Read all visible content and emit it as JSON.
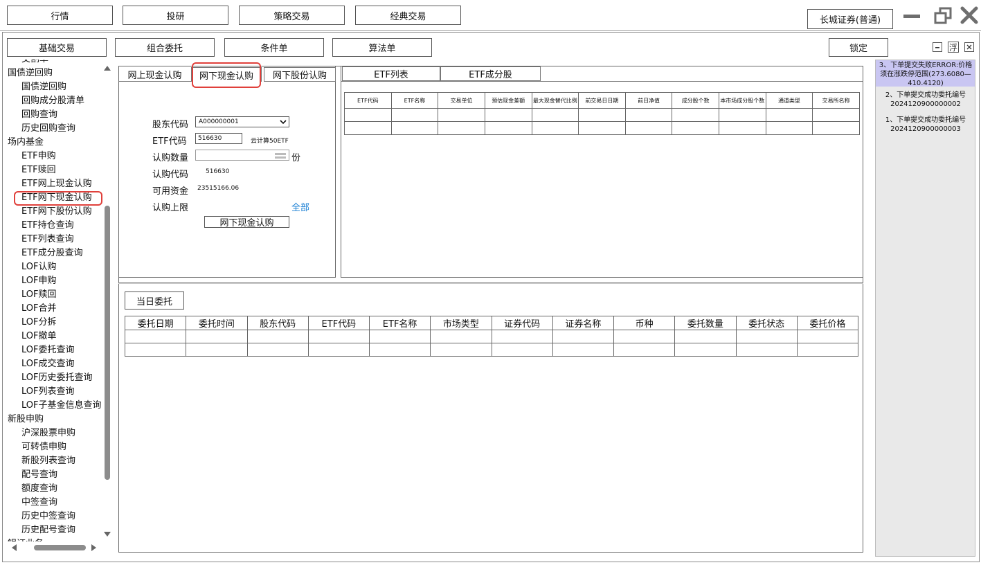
{
  "top_menu": {
    "items": [
      "行情",
      "投研",
      "策略交易",
      "经典交易"
    ],
    "broker_label": "长城证券(普通)"
  },
  "sub_menu": {
    "items": [
      "基础交易",
      "组合委托",
      "条件单",
      "算法单"
    ],
    "lock_label": "锁定"
  },
  "sidebar": {
    "rows": [
      {
        "label": "交割单",
        "level": 1
      },
      {
        "label": "国债逆回购",
        "level": 0
      },
      {
        "label": "国债逆回购",
        "level": 1
      },
      {
        "label": "回购成分股清单",
        "level": 1
      },
      {
        "label": "回购查询",
        "level": 1
      },
      {
        "label": "历史回购查询",
        "level": 1
      },
      {
        "label": "场内基金",
        "level": 0
      },
      {
        "label": "ETF申购",
        "level": 1
      },
      {
        "label": "ETF赎回",
        "level": 1
      },
      {
        "label": "ETF网上现金认购",
        "level": 1
      },
      {
        "label": "ETF网下现金认购",
        "level": 1
      },
      {
        "label": "ETF网下股份认购",
        "level": 1
      },
      {
        "label": "ETF持仓查询",
        "level": 1
      },
      {
        "label": "ETF列表查询",
        "level": 1
      },
      {
        "label": "ETF成分股查询",
        "level": 1
      },
      {
        "label": "LOF认购",
        "level": 1
      },
      {
        "label": "LOF申购",
        "level": 1
      },
      {
        "label": "LOF赎回",
        "level": 1
      },
      {
        "label": "LOF合并",
        "level": 1
      },
      {
        "label": "LOF分拆",
        "level": 1
      },
      {
        "label": "LOF撤单",
        "level": 1
      },
      {
        "label": "LOF委托查询",
        "level": 1
      },
      {
        "label": "LOF成交查询",
        "level": 1
      },
      {
        "label": "LOF历史委托查询",
        "level": 1
      },
      {
        "label": "LOF列表查询",
        "level": 1
      },
      {
        "label": "LOF子基金信息查询",
        "level": 1
      },
      {
        "label": "新股申购",
        "level": 0
      },
      {
        "label": "沪深股票申购",
        "level": 1
      },
      {
        "label": "可转债申购",
        "level": 1
      },
      {
        "label": "新股列表查询",
        "level": 1
      },
      {
        "label": "配号查询",
        "level": 1
      },
      {
        "label": "额度查询",
        "level": 1
      },
      {
        "label": "中签查询",
        "level": 1
      },
      {
        "label": "历史中签查询",
        "level": 1
      },
      {
        "label": "历史配号查询",
        "level": 1
      },
      {
        "label": "银证业务",
        "level": 0
      }
    ],
    "selected": "ETF网下现金认购"
  },
  "form_tabs": [
    "网上现金认购",
    "网下现金认购",
    "网下股份认购"
  ],
  "form": {
    "shareholder_label": "股东代码",
    "shareholder_value": "A000000001",
    "etf_code_label": "ETF代码",
    "etf_code_value": "516630",
    "etf_name": "云计算50ETF",
    "quantity_label": "认购数量",
    "quantity_unit": "份",
    "sub_code_label": "认购代码",
    "sub_code_value": "516630",
    "funds_label": "可用资金",
    "funds_value": "23515166.06",
    "limit_label": "认购上限",
    "all_link": "全部",
    "submit_label": "网下现金认购"
  },
  "etf_tabs": [
    "ETF列表",
    "ETF成分股"
  ],
  "etf_table": {
    "columns": [
      "ETF代码",
      "ETF名称",
      "交易单位",
      "预估现金差额",
      "最大现金替代比例",
      "前交易日日期",
      "前日净值",
      "成分股个数",
      "本市场成分股个数",
      "通道类型",
      "交易所名称"
    ]
  },
  "orders": {
    "button": "当日委托",
    "columns": [
      "委托日期",
      "委托时间",
      "股东代码",
      "ETF代码",
      "ETF名称",
      "市场类型",
      "证券代码",
      "证券名称",
      "币种",
      "委托数量",
      "委托状态",
      "委托价格"
    ]
  },
  "messages": [
    {
      "text": "3、下单提交失败ERROR:价格须在涨跌停范围(273.6080—410.4120)",
      "status": "error"
    },
    {
      "text": "2、下单提交成功委托编号2024120900000002",
      "status": "ok"
    },
    {
      "text": "1、下单提交成功委托编号2024120900000003",
      "status": "ok"
    }
  ],
  "colors": {
    "highlight": "#e0403b",
    "error_bg": "#c9c6f2",
    "link": "#1a7fd4",
    "panel_bg": "#e9e9e9"
  }
}
